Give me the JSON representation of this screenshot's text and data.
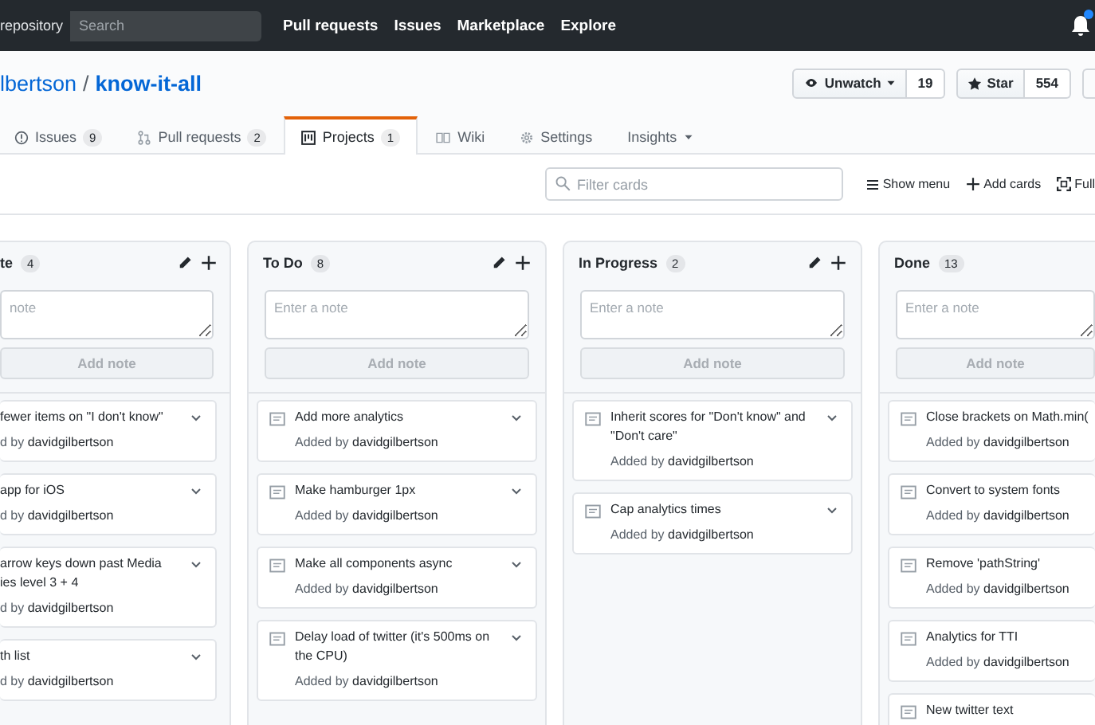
{
  "top_nav": {
    "scope_label": "repository",
    "search": {
      "placeholder": "Search"
    },
    "links": [
      "Pull requests",
      "Issues",
      "Marketplace",
      "Explore"
    ],
    "notifications_unread": true
  },
  "repo": {
    "owner": "lbertson",
    "separator": "/",
    "name": "know-it-all",
    "actions": [
      {
        "label": "Unwatch",
        "caret": true,
        "count": "19"
      },
      {
        "label": "Star",
        "caret": false,
        "count": "554"
      }
    ]
  },
  "tabs": [
    {
      "label": "Issues",
      "count": "9",
      "selected": false
    },
    {
      "label": "Pull requests",
      "count": "2",
      "selected": false
    },
    {
      "label": "Projects",
      "count": "1",
      "selected": true
    },
    {
      "label": "Wiki",
      "selected": false
    },
    {
      "label": "Settings",
      "selected": false
    },
    {
      "label": "Insights",
      "caret": true,
      "selected": false
    }
  ],
  "toolbar": {
    "filter": {
      "placeholder": "Filter cards"
    },
    "actions": [
      "Show menu",
      "Add cards",
      "Full"
    ]
  },
  "columns": [
    {
      "name": "te",
      "count": "4",
      "note_placeholder": "note",
      "add_note": {
        "label": "Add note",
        "disabled": true
      },
      "cards": [
        {
          "title": "fewer items on \"I don't know\"",
          "added": "d by",
          "author": "davidgilbertson"
        },
        {
          "title": "app for iOS",
          "added": "d by",
          "author": "davidgilbertson"
        },
        {
          "title": "arrow keys down past Media ies level 3 + 4",
          "added": "d by",
          "author": "davidgilbertson"
        },
        {
          "title": "th list",
          "added": "d by",
          "author": "davidgilbertson"
        }
      ]
    },
    {
      "name": "To Do",
      "count": "8",
      "note_placeholder": "Enter a note",
      "add_note": {
        "label": "Add note",
        "disabled": true
      },
      "cards": [
        {
          "title": "Add more analytics",
          "added": "Added by",
          "author": "davidgilbertson"
        },
        {
          "title": "Make hamburger 1px",
          "added": "Added by",
          "author": "davidgilbertson"
        },
        {
          "title": "Make all components async",
          "added": "Added by",
          "author": "davidgilbertson"
        },
        {
          "title": "Delay load of twitter (it's 500ms on the CPU)",
          "added": "Added by",
          "author": "davidgilbertson"
        }
      ]
    },
    {
      "name": "In Progress",
      "count": "2",
      "note_placeholder": "Enter a note",
      "add_note": {
        "label": "Add note",
        "disabled": true
      },
      "cards": [
        {
          "title": "Inherit scores for \"Don't know\" and \"Don't care\"",
          "added": "Added by",
          "author": "davidgilbertson"
        },
        {
          "title": "Cap analytics times",
          "added": "Added by",
          "author": "davidgilbertson"
        }
      ]
    },
    {
      "name": "Done",
      "count": "13",
      "note_placeholder": "Enter a note",
      "add_note": {
        "label": "Add note",
        "disabled": true
      },
      "cards": [
        {
          "title": "Close brackets on Math.min(",
          "added": "Added by",
          "author": "davidgilbertson"
        },
        {
          "title": "Convert to system fonts",
          "added": "Added by",
          "author": "davidgilbertson"
        },
        {
          "title": "Remove 'pathString'",
          "added": "Added by",
          "author": "davidgilbertson"
        },
        {
          "title": "Analytics for TTI",
          "added": "Added by",
          "author": "davidgilbertson"
        },
        {
          "title": "New twitter text"
        }
      ]
    }
  ]
}
